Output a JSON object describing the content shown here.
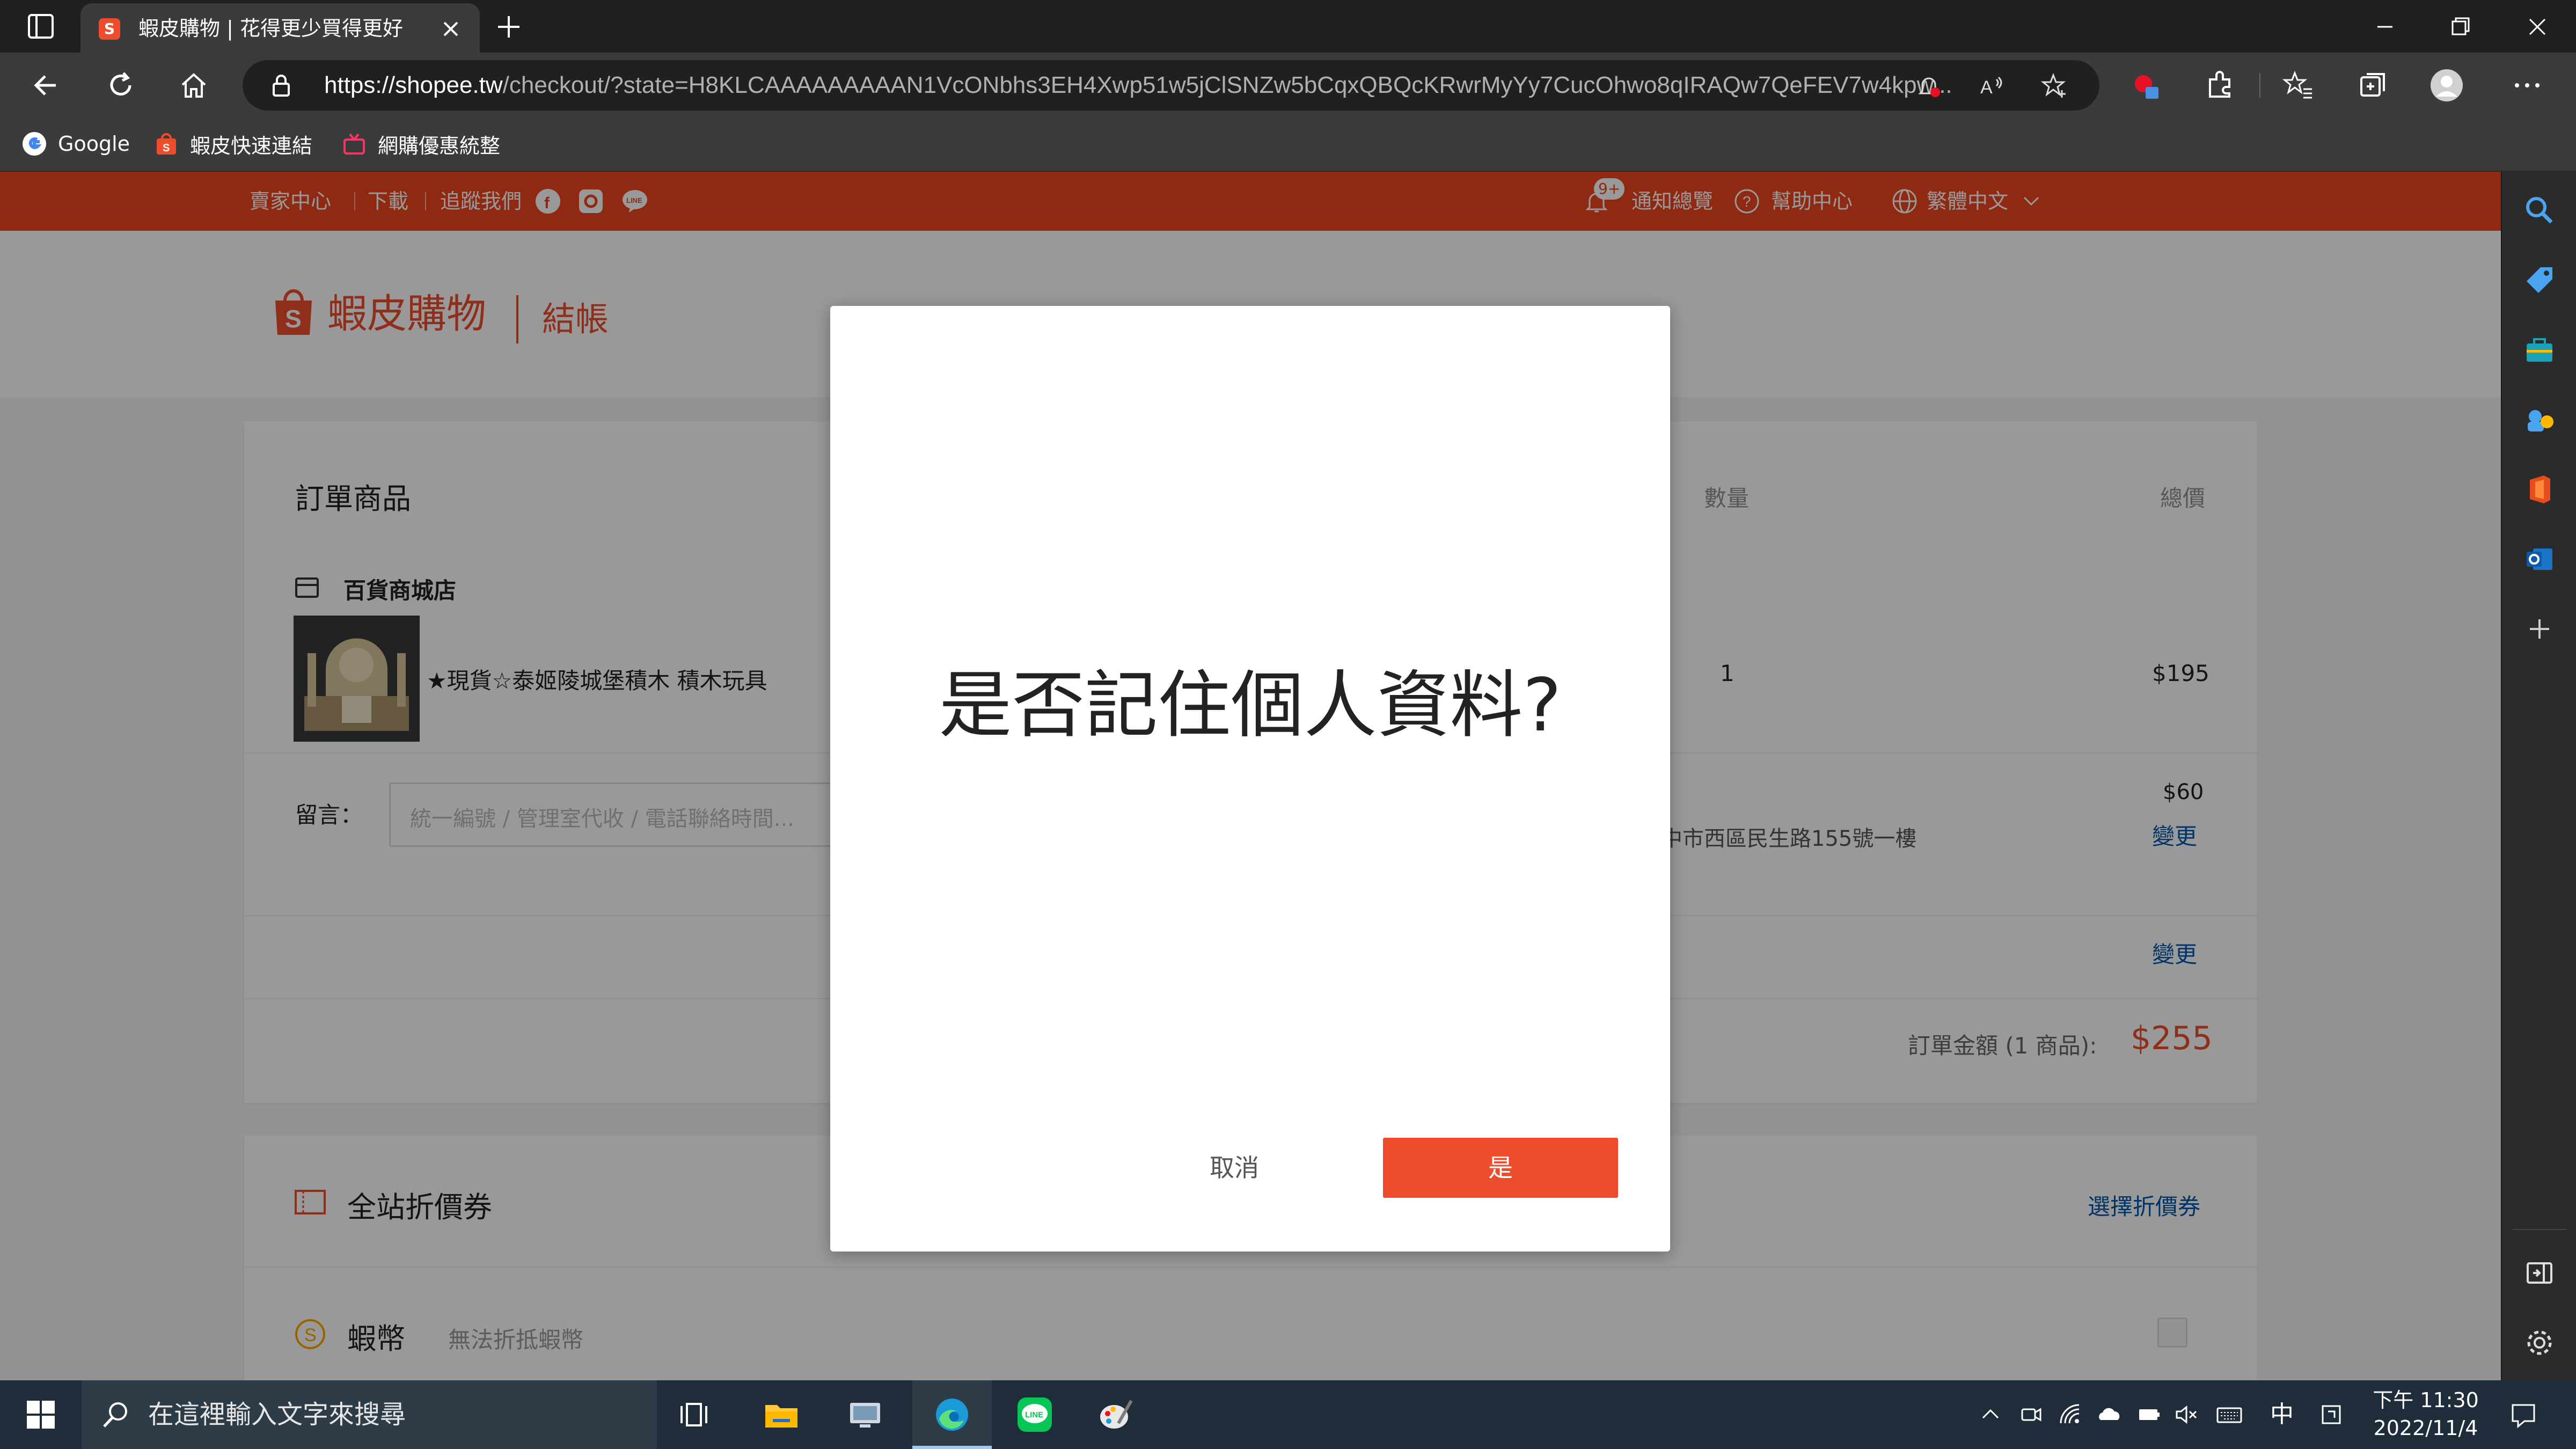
{
  "browser": {
    "tab_title": "蝦皮購物 | 花得更少買得更好",
    "url_host": "https://shopee.tw",
    "url_rest": "/checkout/?state=H8KLCAAAAAAAAAN1VcONbhs3EH4Xwp51w5jClSNZw5bCqxQBQcKRwrMyYy7CucOhwo8qIRAQw7QeFEV7w4kpw...",
    "favorites": [
      {
        "label": "Google"
      },
      {
        "label": "蝦皮快速連結"
      },
      {
        "label": "網購優惠統整"
      }
    ]
  },
  "shopee": {
    "topbar": {
      "seller_center": "賣家中心",
      "download": "下載",
      "follow_us": "追蹤我們",
      "notification_badge": "9+",
      "notifications": "通知總覽",
      "help": "幫助中心",
      "language": "繁體中文"
    },
    "brand": "蝦皮購物",
    "page_title": "結帳",
    "order": {
      "header": "訂單商品",
      "col_qty": "數量",
      "col_total": "總價",
      "shop_name": "百貨商城店",
      "product_name": "★現貨☆泰姬陵城堡積木 積木玩具",
      "qty": "1",
      "price": "$195",
      "message_label": "留言：",
      "message_placeholder": "統一編號 / 管理室代收 / 電話聯絡時間...",
      "shipping_fee": "$60",
      "address_partial": "中市西區民生路155號一樓",
      "change_link": "變更",
      "change_link2": "變更",
      "subtotal_label": "訂單金額 (1 商品):",
      "subtotal_value": "$255"
    },
    "voucher": {
      "title": "全站折價券",
      "select_link": "選擇折價券"
    },
    "coins": {
      "title": "蝦幣",
      "note": "無法折抵蝦幣"
    }
  },
  "modal": {
    "message": "是否記住個人資料?",
    "cancel_label": "取消",
    "confirm_label": "是"
  },
  "taskbar": {
    "search_placeholder": "在這裡輸入文字來搜尋",
    "ime": "中",
    "time": "下午 11:30",
    "date": "2022/11/4"
  },
  "colors": {
    "shopee_orange": "#ee4d2d",
    "topbar_orange": "#f1451f",
    "link_blue": "#05a"
  }
}
